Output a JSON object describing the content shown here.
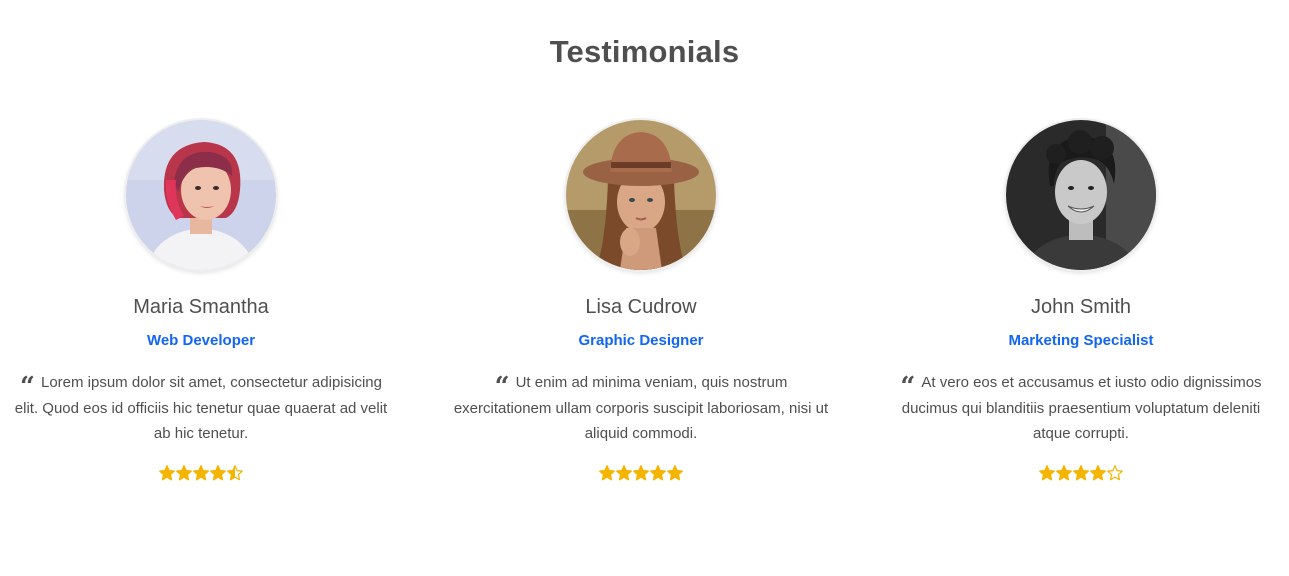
{
  "section": {
    "title": "Testimonials"
  },
  "colors": {
    "title": "#4f4f4f",
    "role": "#1266f1",
    "star": "#f4b400"
  },
  "testimonials": [
    {
      "name": "Maria Smantha",
      "role": "Web Developer",
      "quote_icon": "quote-left-icon",
      "quote": "Lorem ipsum dolor sit amet, consectetur adipisicing elit. Quod eos id officiis hic tenetur quae quaerat ad velit ab hic tenetur.",
      "rating": 4.5,
      "avatar_icon": "avatar-photo"
    },
    {
      "name": "Lisa Cudrow",
      "role": "Graphic Designer",
      "quote_icon": "quote-left-icon",
      "quote": "Ut enim ad minima veniam, quis nostrum exercitationem ullam corporis suscipit laboriosam, nisi ut aliquid commodi.",
      "rating": 5,
      "avatar_icon": "avatar-photo"
    },
    {
      "name": "John Smith",
      "role": "Marketing Specialist",
      "quote_icon": "quote-left-icon",
      "quote": "At vero eos et accusamus et iusto odio dignissimos ducimus qui blanditiis praesentium voluptatum deleniti atque corrupti.",
      "rating": 4,
      "avatar_icon": "avatar-photo"
    }
  ]
}
